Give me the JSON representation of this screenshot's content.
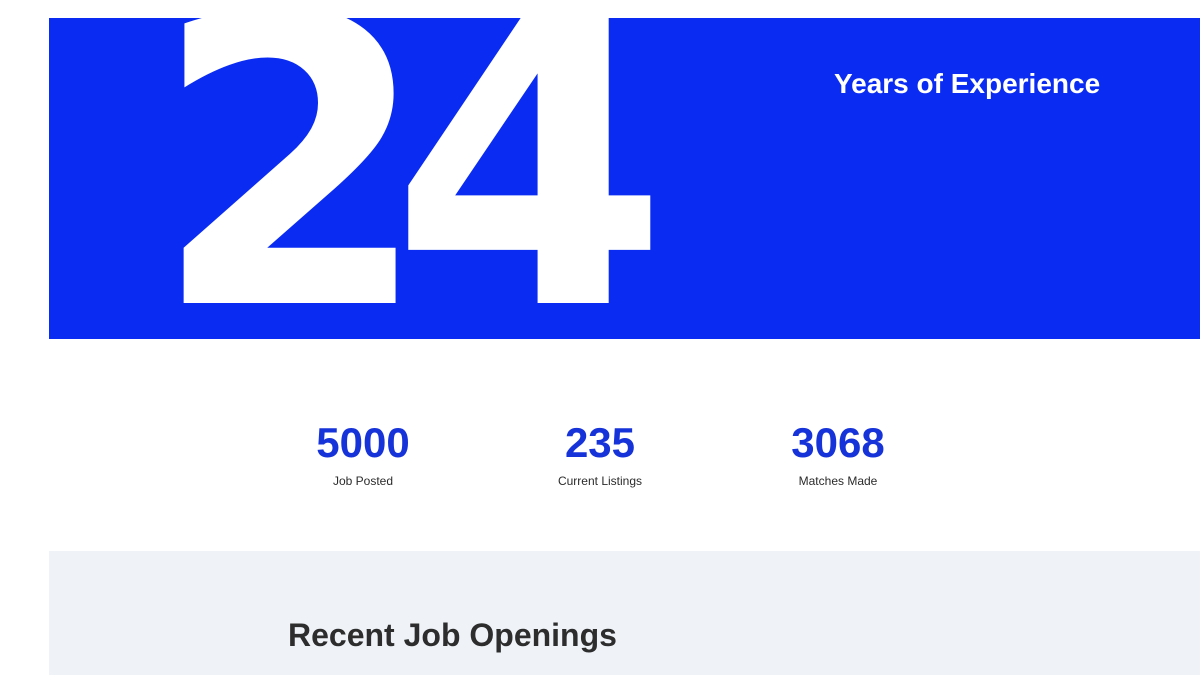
{
  "hero": {
    "big_number": "24",
    "label": "Years of Experience",
    "accent_color": "#0a2cf2"
  },
  "stats": [
    {
      "value": "5000",
      "label": "Job Posted"
    },
    {
      "value": "235",
      "label": "Current Listings"
    },
    {
      "value": "3068",
      "label": "Matches Made"
    }
  ],
  "openings": {
    "title": "Recent Job Openings"
  }
}
